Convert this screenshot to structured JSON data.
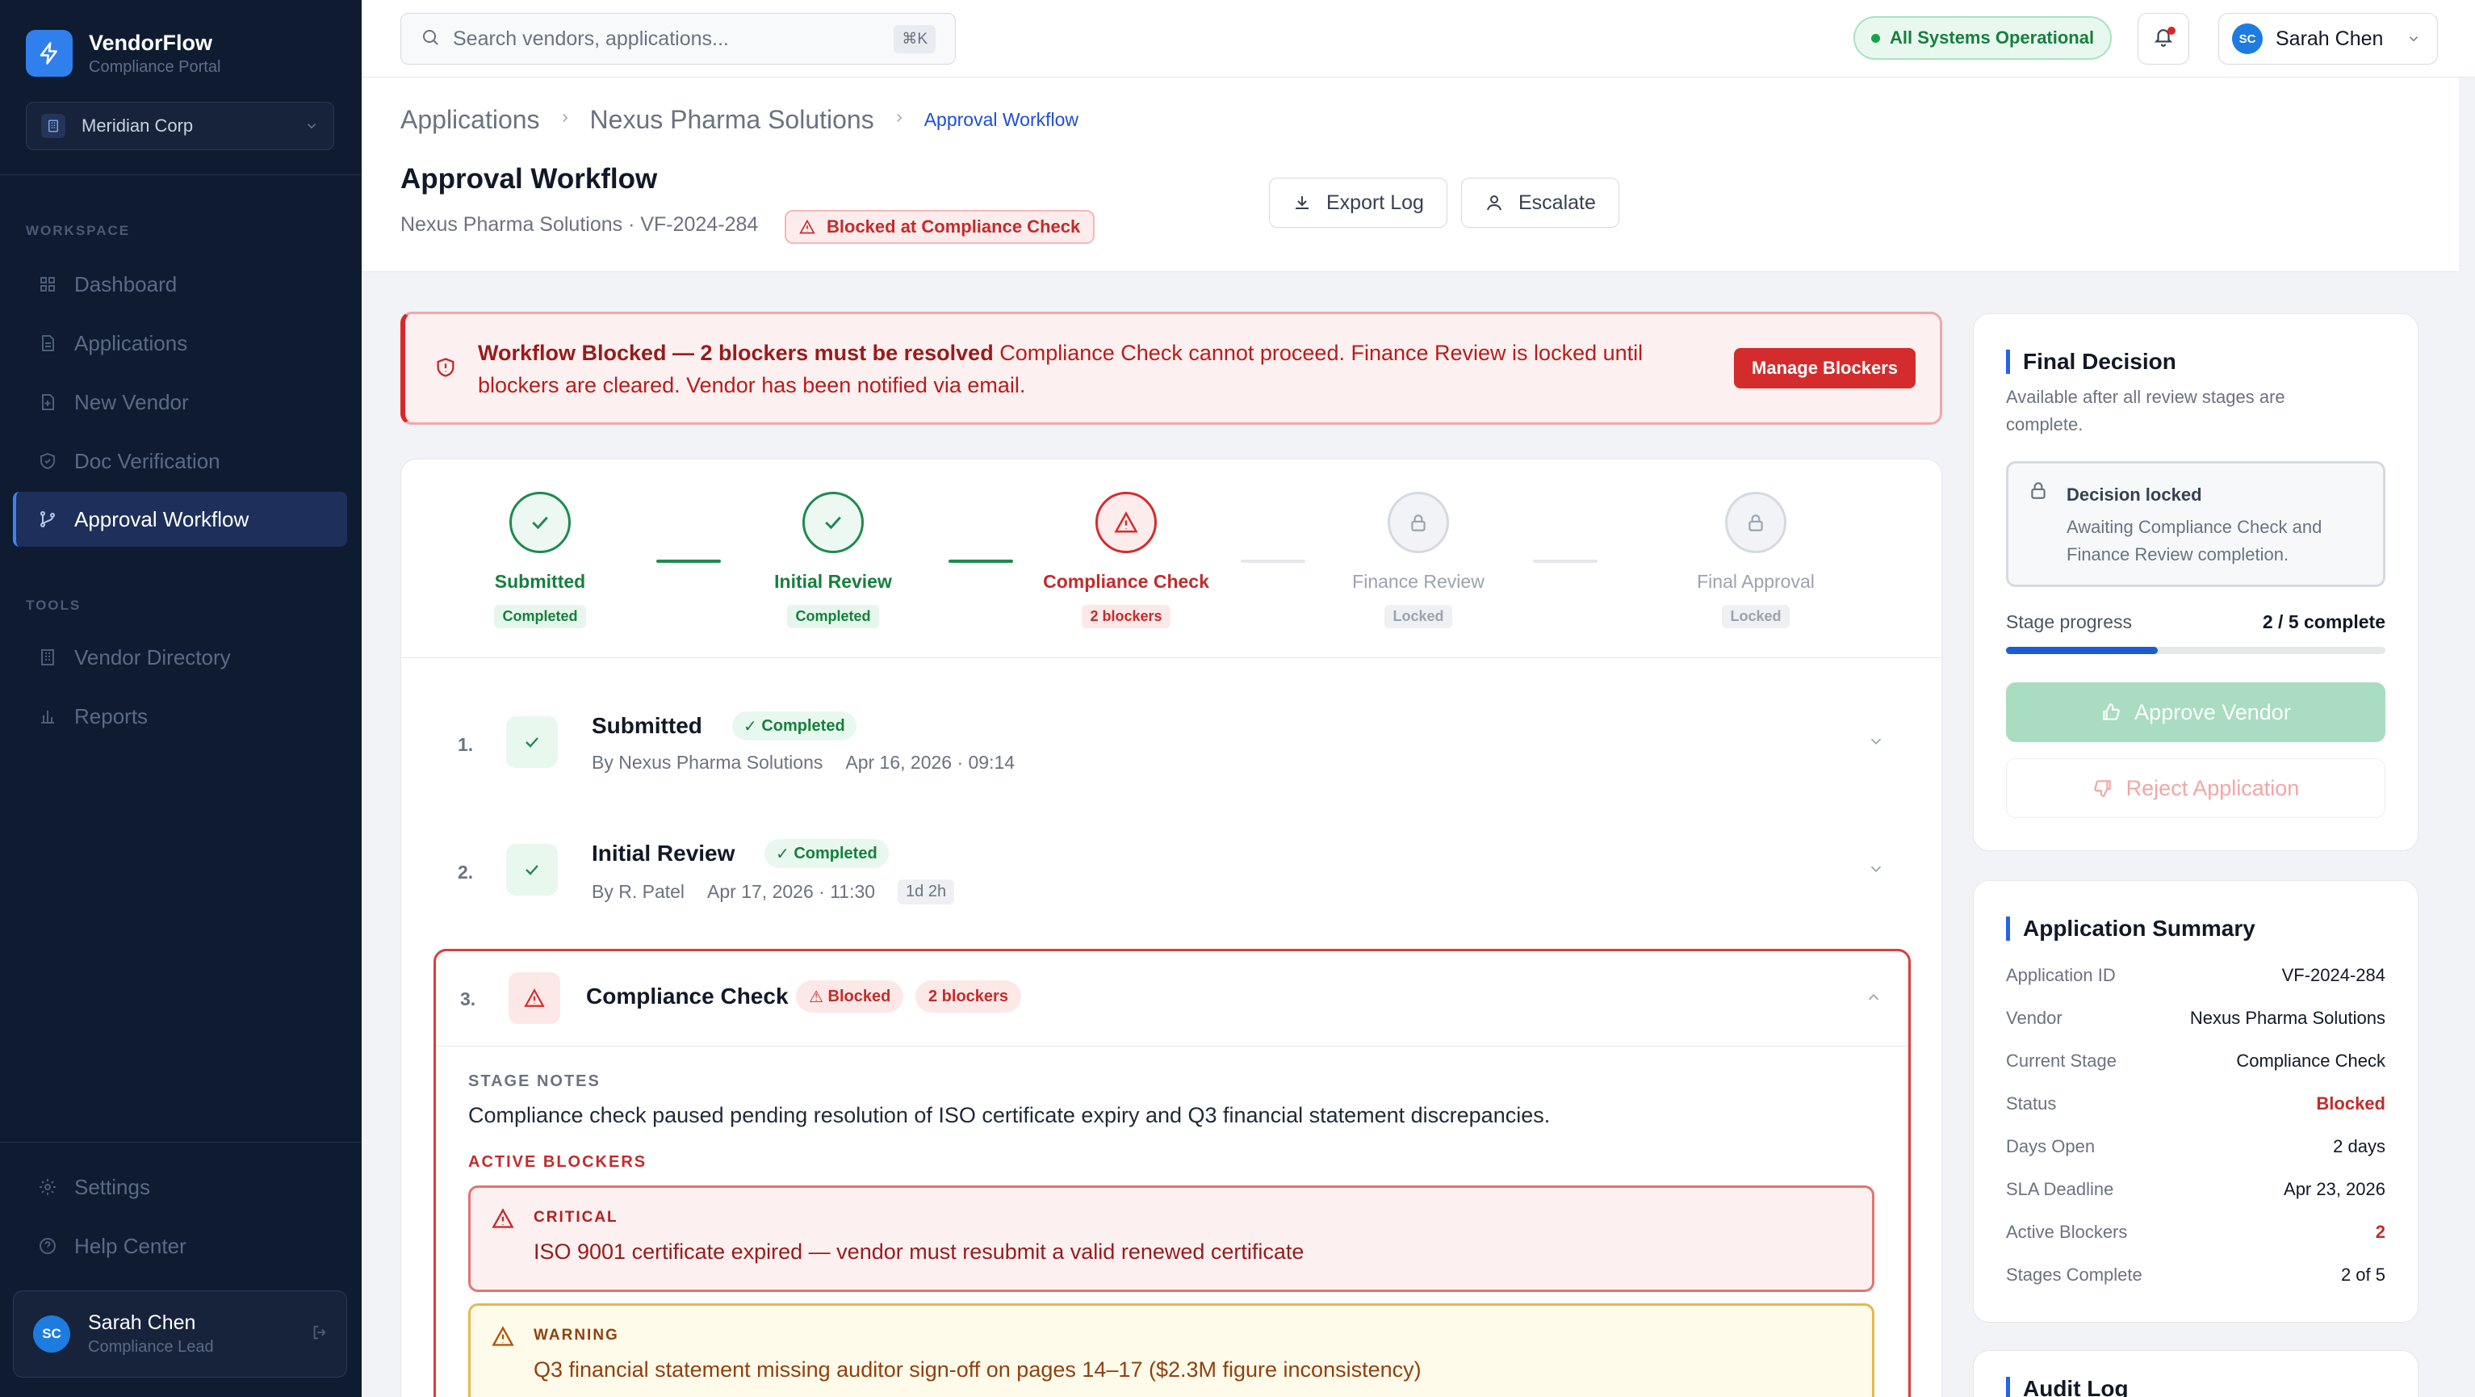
{
  "app": {
    "name": "VendorFlow",
    "subtitle": "Compliance Portal",
    "org": "Meridian Corp"
  },
  "sidebar": {
    "workspace_label": "WORKSPACE",
    "workspace_items": [
      {
        "label": "Dashboard",
        "icon": "grid-icon"
      },
      {
        "label": "Applications",
        "icon": "document-icon"
      },
      {
        "label": "New Vendor",
        "icon": "file-plus-icon"
      },
      {
        "label": "Doc Verification",
        "icon": "shield-check-icon"
      },
      {
        "label": "Approval Workflow",
        "icon": "git-branch-icon",
        "active": true
      }
    ],
    "tools_label": "TOOLS",
    "tools_items": [
      {
        "label": "Vendor Directory",
        "icon": "building-icon"
      },
      {
        "label": "Reports",
        "icon": "bar-chart-icon"
      }
    ],
    "bottom_items": [
      {
        "label": "Settings",
        "icon": "gear-icon"
      },
      {
        "label": "Help Center",
        "icon": "help-circle-icon"
      }
    ],
    "user": {
      "initials": "SC",
      "name": "Sarah Chen",
      "role": "Compliance Lead"
    }
  },
  "topbar": {
    "search_placeholder": "Search vendors, applications...",
    "shortcut": "⌘K",
    "system_status": "All Systems Operational",
    "user_initials": "SC",
    "user_name": "Sarah Chen"
  },
  "header": {
    "breadcrumbs": [
      "Applications",
      "Nexus Pharma Solutions",
      "Approval Workflow"
    ],
    "title": "Approval Workflow",
    "subtitle": "Nexus Pharma Solutions · VF-2024-284",
    "status_badge": "Blocked at Compliance Check",
    "export_label": "Export Log",
    "escalate_label": "Escalate"
  },
  "alert": {
    "title": "Workflow Blocked — 2 blockers must be resolved",
    "body": "Compliance Check cannot proceed. Finance Review is locked until blockers are cleared. Vendor has been notified via email.",
    "action": "Manage Blockers"
  },
  "stepper": [
    {
      "name": "Submitted",
      "badge": "Completed",
      "state": "done"
    },
    {
      "name": "Initial Review",
      "badge": "Completed",
      "state": "done"
    },
    {
      "name": "Compliance Check",
      "badge": "2 blockers",
      "state": "block"
    },
    {
      "name": "Finance Review",
      "badge": "Locked",
      "state": "lock"
    },
    {
      "name": "Final Approval",
      "badge": "Locked",
      "state": "lock"
    }
  ],
  "stages": [
    {
      "num": "1.",
      "title": "Submitted",
      "tag": "Completed",
      "by": "By Nexus Pharma Solutions",
      "when": "Apr 16, 2026 · 09:14"
    },
    {
      "num": "2.",
      "title": "Initial Review",
      "tag": "Completed",
      "by": "By R. Patel",
      "when": "Apr 17, 2026 · 11:30",
      "duration": "1d 2h"
    },
    {
      "num": "3.",
      "title": "Compliance Check",
      "tag": "Blocked",
      "tag2": "2 blockers",
      "notes_label": "STAGE NOTES",
      "notes": "Compliance check paused pending resolution of ISO certificate expiry and Q3 financial statement discrepancies.",
      "blockers_label": "ACTIVE BLOCKERS",
      "blockers": [
        {
          "level": "CRITICAL",
          "text": "ISO 9001 certificate expired — vendor must resubmit a valid renewed certificate"
        },
        {
          "level": "WARNING",
          "text": "Q3 financial statement missing auditor sign-off on pages 14–17 ($2.3M figure inconsistency)"
        }
      ]
    }
  ],
  "final_decision": {
    "title": "Final Decision",
    "subtitle": "Available after all review stages are complete.",
    "locked_title": "Decision locked",
    "locked_body": "Awaiting Compliance Check and Finance Review completion.",
    "progress_label": "Stage progress",
    "progress_value": "2 / 5 complete",
    "progress_fraction": 0.4,
    "approve_label": "Approve Vendor",
    "reject_label": "Reject Application"
  },
  "summary": {
    "title": "Application Summary",
    "rows": [
      {
        "k": "Application ID",
        "v": "VF-2024-284"
      },
      {
        "k": "Vendor",
        "v": "Nexus Pharma Solutions"
      },
      {
        "k": "Current Stage",
        "v": "Compliance Check"
      },
      {
        "k": "Status",
        "v": "Blocked"
      },
      {
        "k": "Days Open",
        "v": "2 days"
      },
      {
        "k": "SLA Deadline",
        "v": "Apr 23, 2026"
      },
      {
        "k": "Active Blockers",
        "v": "2"
      },
      {
        "k": "Stages Complete",
        "v": "2 of 5"
      }
    ]
  },
  "audit_log": {
    "title": "Audit Log"
  },
  "colors": {
    "accent": "#2563eb",
    "danger": "#dc2626",
    "success": "#15803d",
    "warning": "#d97706",
    "sidebar_bg": "#0f1b31"
  }
}
